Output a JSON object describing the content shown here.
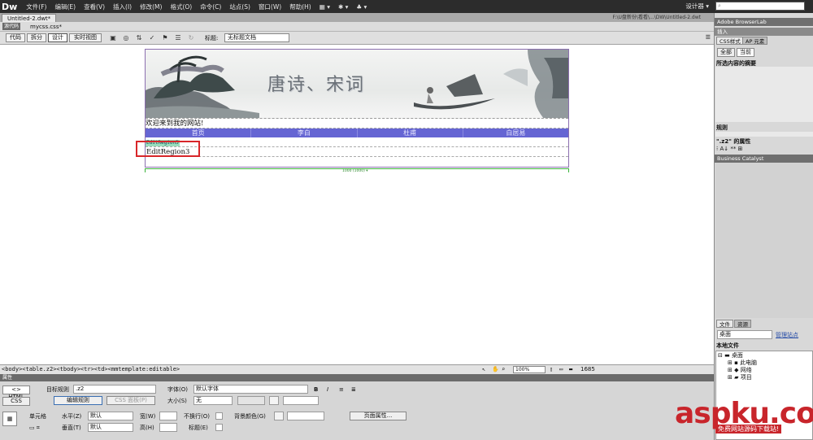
{
  "menubar": {
    "logo": "Dw",
    "items": [
      "文件(F)",
      "编辑(E)",
      "查看(V)",
      "插入(I)",
      "修改(M)",
      "格式(O)",
      "命令(C)",
      "站点(S)",
      "窗口(W)",
      "帮助(H)"
    ],
    "workspace": "设计器 ▾"
  },
  "document": {
    "tab": "Untitled-2.dwt*",
    "path": "F:\\U盘新份\\看看\\...\\DW\\Untitled-2.dwt",
    "related_source": "源代码",
    "related_file": "mycss.css*"
  },
  "toolbar": {
    "views": [
      "代码",
      "拆分",
      "设计",
      "实时视图"
    ],
    "active_view": "设计",
    "title_label": "标题:",
    "title_value": "无标题文档"
  },
  "design": {
    "banner_title": "唐诗、宋词",
    "welcome": "欢迎来到我的网站!",
    "nav": [
      "首页",
      "李白",
      "杜甫",
      "白居易"
    ],
    "region_tag": "EditRegion3",
    "region_content": "EditRegion3",
    "width_ruler": "1000 (1000) ▾"
  },
  "statusbar": {
    "tag_selector": "<body><table.z2><tbody><tr><td><mmtemplate:editable>",
    "zoom": "100%",
    "window_size": "1685"
  },
  "properties": {
    "header": "属性",
    "html_btn": "<> HTML",
    "css_btn": "CSS",
    "target_rule_label": "目标规则",
    "target_rule_value": ".z2",
    "edit_rule": "编辑规则",
    "css_panel": "CSS 面板(P)",
    "font_label": "字体(O)",
    "font_value": "默认字体",
    "size_label": "大小(S)",
    "size_value": "无",
    "cell_label": "单元格",
    "h_align_label": "水平(Z)",
    "h_align_value": "默认",
    "v_align_label": "垂直(T)",
    "v_align_value": "默认",
    "width_label": "宽(W)",
    "height_label": "高(H)",
    "nowrap_label": "不换行(O)",
    "header_label": "标题(E)",
    "bg_label": "背景颜色(G)",
    "page_props": "页面属性..."
  },
  "rightpanel": {
    "browserlab": "Adobe BrowserLab",
    "insert": "插入",
    "css_styles_tab": "CSS样式",
    "ap_tab": "AP 元素",
    "all_btn": "全部",
    "current_btn": "当前",
    "summary": "所选内容的摘要",
    "rules": "规则",
    "props_of": "\".z2\" 的属性",
    "catalyst": "Business Catalyst",
    "files_tab": "文件",
    "assets_tab": "资源",
    "site_select": "桌面",
    "manage_sites": "管理站点",
    "local_files": "本地文件",
    "tree": [
      "桌面",
      "此电脑",
      "网络",
      "项目"
    ]
  },
  "watermark": {
    "main": "aspku.com",
    "sub": "免费网站源码下载站!"
  }
}
